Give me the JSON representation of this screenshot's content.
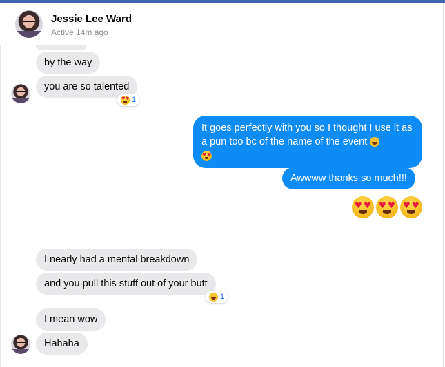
{
  "contact": {
    "name": "Jessie Lee Ward",
    "status": "Active 14m ago"
  },
  "messages": [
    {
      "from": "them",
      "text": "by the way"
    },
    {
      "from": "them",
      "text": "you are so talented",
      "reaction": {
        "emoji": "heart-eyes",
        "count": "1"
      }
    },
    {
      "from": "me",
      "text": "It goes perfectly with you so I thought I use it as a pun too bc of the name of the event"
    },
    {
      "from": "me",
      "text": "Awwww thanks so much!!!"
    },
    {
      "from": "me",
      "emoji_only": [
        "heart-eyes",
        "heart-eyes",
        "heart-eyes"
      ]
    },
    {
      "from": "them",
      "text": "I nearly had a mental breakdown"
    },
    {
      "from": "them",
      "text": "and you pull this stuff out of your butt",
      "reaction": {
        "emoji": "grinning-sweat",
        "count": "1"
      }
    },
    {
      "from": "them",
      "text": "I mean wow"
    },
    {
      "from": "them",
      "text": "Hahaha"
    }
  ],
  "colors": {
    "outgoing": "#0d8cf8",
    "incoming": "#e9e9eb",
    "accent_bar": "#4267b2"
  }
}
